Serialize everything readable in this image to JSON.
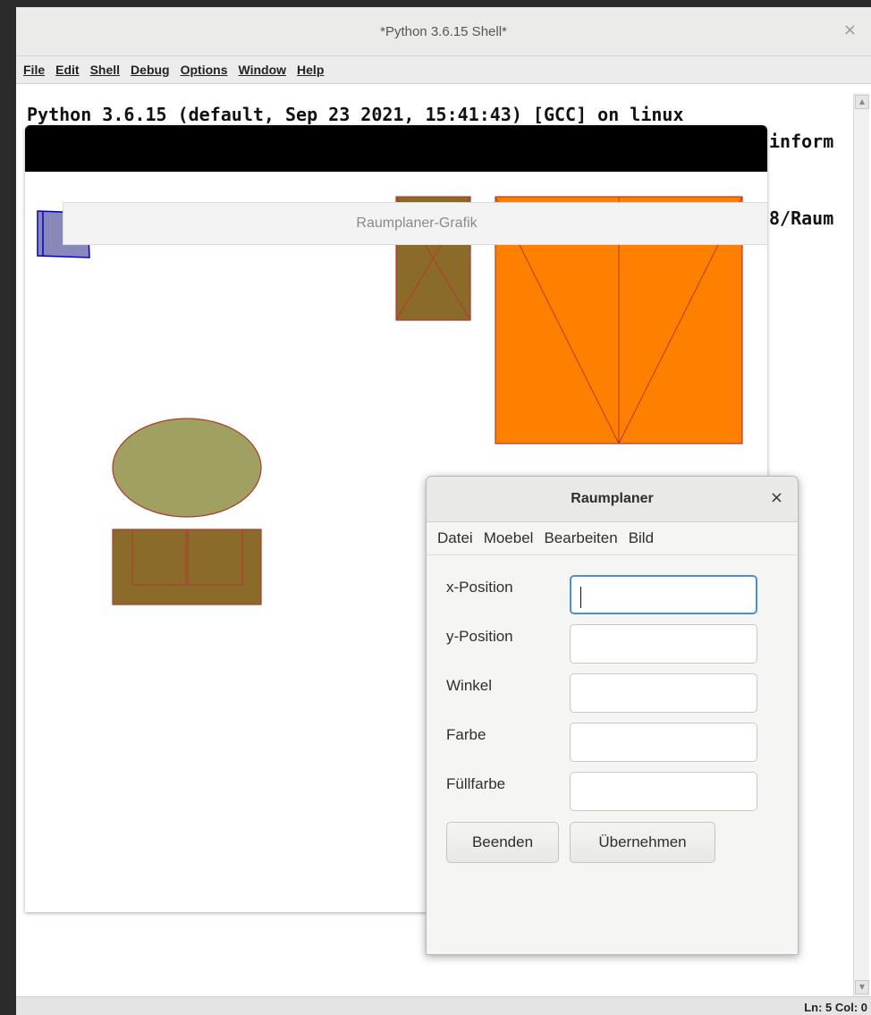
{
  "shell": {
    "title": "*Python 3.6.15 Shell*",
    "close_glyph": "×",
    "menu": [
      "File",
      "Edit",
      "Shell",
      "Debug",
      "Options",
      "Window",
      "Help"
    ],
    "lines": [
      "Python 3.6.15 (default, Sep 23 2021, 15:41:43) [GCC] on linux",
      "inform",
      "8/Raum"
    ],
    "status": "Ln: 5   Col: 0"
  },
  "graphic": {
    "tooltip": "Raumplaner-Grafik",
    "shapes": [
      {
        "name": "chair-blue",
        "stroke": "#0000cc",
        "fill": "#8888bb"
      },
      {
        "name": "cabinet-small",
        "stroke": "#b03a2e",
        "fill": "#8b6b2a"
      },
      {
        "name": "double-bed",
        "stroke": "#b03a2e",
        "fill": "#ff8000"
      },
      {
        "name": "round-table",
        "stroke": "#b03a2e",
        "fill": "#a0a060"
      },
      {
        "name": "sofa",
        "stroke": "#b03a2e",
        "fill": "#8b6b2a"
      }
    ]
  },
  "dialog": {
    "title": "Raumplaner",
    "close_glyph": "×",
    "menu": [
      "Datei",
      "Moebel",
      "Bearbeiten",
      "Bild"
    ],
    "fields": [
      {
        "label": "x-Position",
        "value": ""
      },
      {
        "label": "y-Position",
        "value": ""
      },
      {
        "label": "Winkel",
        "value": ""
      },
      {
        "label": "Farbe",
        "value": ""
      },
      {
        "label": "Füllfarbe",
        "value": ""
      }
    ],
    "buttons": {
      "quit": "Beenden",
      "apply": "Übernehmen"
    }
  }
}
